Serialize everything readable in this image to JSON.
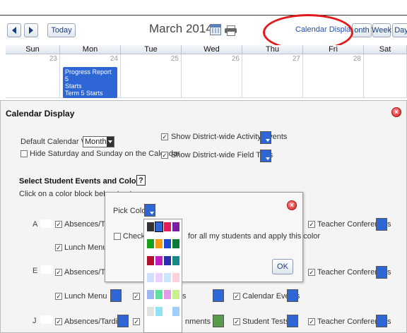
{
  "calendar": {
    "nav": {
      "prev_icon": "chevron-left-icon",
      "next_icon": "chevron-right-icon",
      "today_label": "Today"
    },
    "month_title": "March 2014",
    "calendar_icon": "calendar-icon",
    "print_icon": "print-icon",
    "view_link": "Calendar Display",
    "view_buttons": [
      "onth",
      "Week",
      "Day"
    ],
    "day_headers": [
      "Sun",
      "Mon",
      "Tue",
      "Wed",
      "Thu",
      "Fri",
      "Sat"
    ],
    "day_numbers": [
      "23",
      "24",
      "25",
      "26",
      "27",
      "28",
      ""
    ],
    "event": {
      "line1": "Progress Report 5",
      "line2": "Starts",
      "line3": "Term 5 Starts"
    }
  },
  "dialog": {
    "title": "Calendar Display",
    "default_view_label": "Default Calendar View:",
    "default_view_value": "Month",
    "hide_weekend_label": "Hide Saturday and Sunday on the Calendar",
    "show_activity_label": "Show District-wide Activity Events",
    "show_trips_label": "Show District-wide Field Trips",
    "section_title": "Select Student Events and Colors:",
    "help_label": "?",
    "instruction": "Click on a color block below to st",
    "students": [
      {
        "letter": "A",
        "items": [
          "Absences/Tardie",
          "Teacher Conferences"
        ],
        "row2": [
          "Lunch Menu"
        ]
      },
      {
        "letter": "E",
        "items": [
          "Absences/Tardi",
          "Teacher Conferences"
        ],
        "row2": [
          "Lunch Menu",
          "s",
          "Calendar Events"
        ]
      },
      {
        "letter": "J",
        "items": [
          "Absences/Tardies",
          "nments",
          "Student Tests",
          "Teacher Conferences"
        ]
      }
    ]
  },
  "popup": {
    "pick_color_label": "Pick Color:",
    "check_label_start": "Check A",
    "check_label_end": "for all my students and apply this color",
    "ok_label": "OK"
  },
  "colors": {
    "accent_blue": "#2f66d6",
    "highlight_red": "#e0191b",
    "palette": [
      [
        "#333333",
        "#2f66d6",
        "#e01e5a",
        "#7a1fa2"
      ],
      [
        "#17a01a",
        "#f39c12",
        "#1e4bd1",
        "#0c7a3a"
      ],
      [
        "#b0122e",
        "#c21fc0",
        "#2d2fae",
        "#1a8a87"
      ],
      [
        "#cfe0ff",
        "#e8d2ff",
        "#cbe6ff",
        "#ffd1dc"
      ],
      [
        "#9eb7f2",
        "#5fe0a0",
        "#e59ae8",
        "#c8f08f"
      ],
      [
        "#e2e2e2",
        "#8fe3f5",
        "#ffffff",
        "#9fcfff"
      ]
    ]
  }
}
